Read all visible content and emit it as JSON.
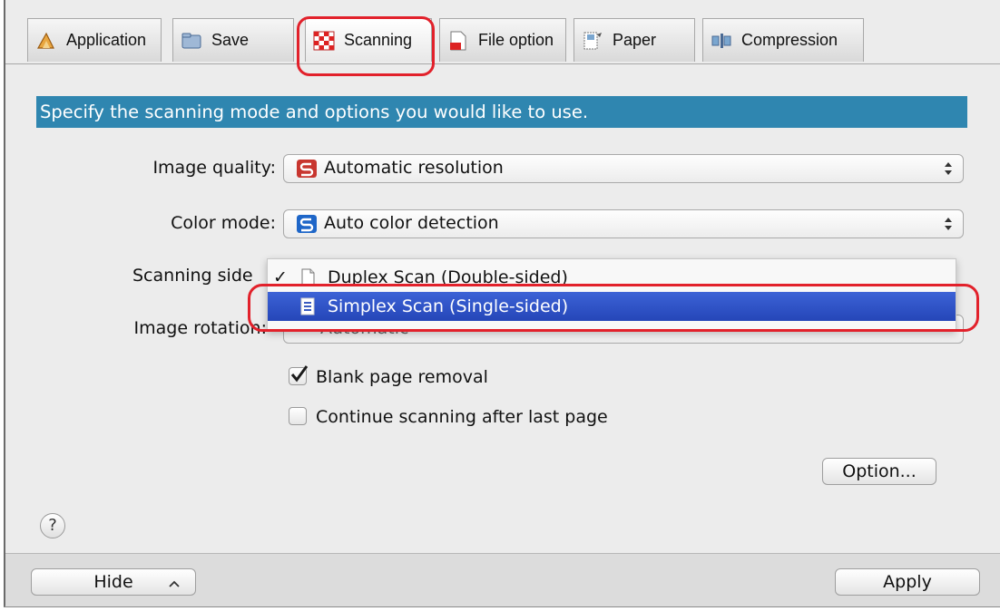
{
  "tabs": [
    {
      "label": "Application",
      "icon": "application-icon"
    },
    {
      "label": "Save",
      "icon": "save-icon"
    },
    {
      "label": "Scanning",
      "icon": "scanning-icon",
      "active": true
    },
    {
      "label": "File option",
      "icon": "file-option-icon"
    },
    {
      "label": "Paper",
      "icon": "paper-icon"
    },
    {
      "label": "Compression",
      "icon": "compression-icon"
    }
  ],
  "banner": "Specify the scanning mode and options you would like to use.",
  "image_quality": {
    "label": "Image quality:",
    "value": "Automatic resolution"
  },
  "color_mode": {
    "label": "Color mode:",
    "value": "Auto color detection"
  },
  "scanning_side": {
    "label": "Scanning side",
    "options": [
      {
        "label": "Duplex Scan (Double-sided)",
        "checked": true
      },
      {
        "label": "Simplex Scan (Single-sided)",
        "highlighted": true
      }
    ]
  },
  "image_rotation": {
    "label": "Image rotation:",
    "value": "Automatic"
  },
  "checkboxes": [
    {
      "label": "Blank page removal",
      "checked": true
    },
    {
      "label": "Continue scanning after last page",
      "checked": false
    }
  ],
  "option_button": "Option...",
  "help_button": "?",
  "hide_button": "Hide",
  "apply_button": "Apply",
  "colors": {
    "banner": "#2f86b0",
    "selection": "#2b4fc4",
    "highlight_ring": "#e2212b"
  }
}
